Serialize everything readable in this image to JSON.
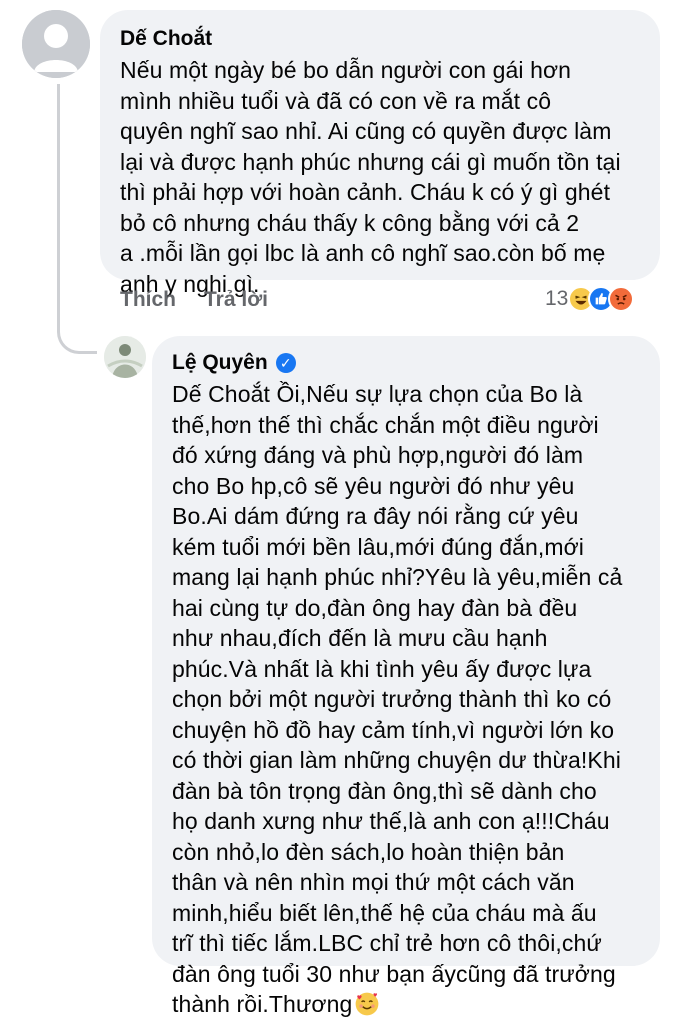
{
  "comment": {
    "author": "Dế Choắt",
    "text": "Nếu một ngày bé bo dẫn người con gái hơn\nmình nhiều tuổi và đã có con về ra mắt cô\nquyên nghĩ sao nhỉ. Ai cũng có quyền được làm\nlại và được hạnh phúc nhưng cái gì muốn tồn tại\nthì phải hợp với hoàn cảnh. Cháu k có ý gì ghét\nbỏ cô nhưng cháu thấy k công bằng với cả 2\na .mỗi  lần  gọi lbc là anh cô nghĩ sao.còn bố mẹ\nanh y nghi gì.",
    "actions": {
      "like_label": "Thích",
      "reply_label": "Trả lời"
    },
    "reaction_count": "13",
    "reactions": [
      "haha-icon",
      "like-icon",
      "angry-icon"
    ]
  },
  "reply": {
    "author": "Lệ Quyên",
    "verified": true,
    "text": "Dế Choắt Ồi,Nếu sự lựa chọn của Bo là\nthế,hơn thế thì chắc chắn một điều người\nđó xứng đáng và phù hợp,người đó làm\ncho Bo hp,cô sẽ yêu người đó như yêu\nBo.Ai dám đứng ra đây nói rằng cứ yêu\nkém tuổi mới bền lâu,mới đúng đắn,mới\nmang lại hạnh phúc nhỉ?Yêu là yêu,miễn cả\nhai cùng tự do,đàn ông hay đàn bà đều\nnhư nhau,đích đến là mưu cầu hạnh\nphúc.Và nhất là khi tình yêu ấy được lựa\nchọn bởi một người trưởng thành thì ko có\nchuyện hồ đồ hay cảm tính,vì người lớn ko\ncó thời gian làm những chuyện dư thừa!Khi\nđàn bà tôn trọng đàn ông,thì sẽ dành cho\nhọ danh xưng như thế,là anh con ạ!!!Cháu\ncòn nhỏ,lo đèn sách,lo hoàn thiện bản\nthân và nên nhìn mọi thứ một cách văn\nminh,hiểu biết lên,thế hệ của cháu mà ấu\ntrĩ thì tiếc lắm.LBC chỉ trẻ hơn cô thôi,chứ\nđàn ông tuổi 30 như bạn ấycũng đã trưởng\nthành rồi.Thương",
    "trailing_emoji": "smiling-face-with-hearts-icon"
  },
  "colors": {
    "bubble": "#f0f2f5",
    "secondary_text": "#65676b",
    "verified": "#1877f2"
  }
}
